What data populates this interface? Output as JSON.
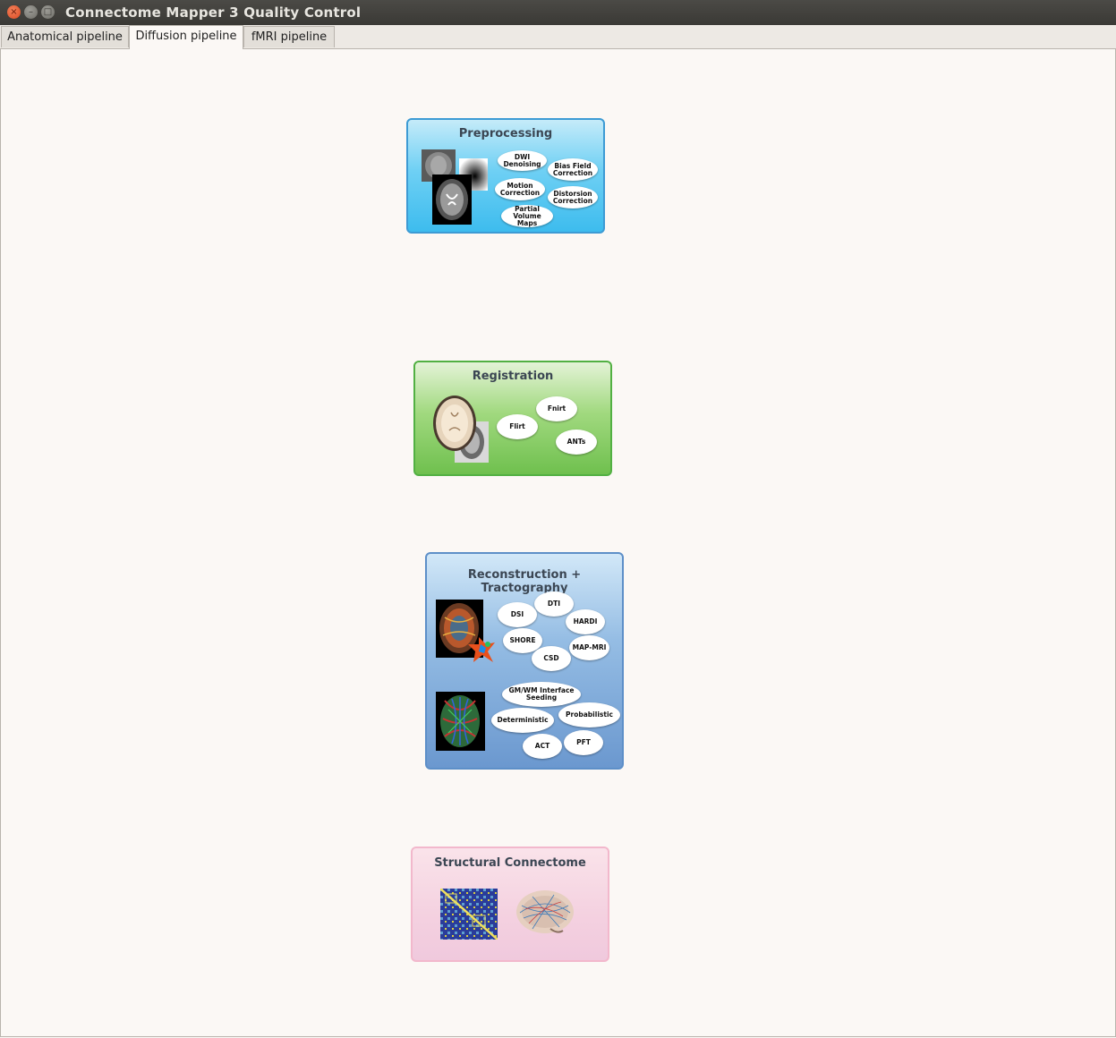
{
  "window": {
    "title": "Connectome Mapper 3 Quality Control",
    "close_symbol": "×",
    "min_symbol": "–",
    "max_symbol": "□"
  },
  "tabs": [
    "Anatomical pipeline",
    "Diffusion pipeline",
    "fMRI pipeline"
  ],
  "active_tab": "Diffusion pipeline",
  "stages": {
    "preprocessing": {
      "title": "Preprocessing",
      "color": "#50c0ee",
      "options": [
        "DWI Denoising",
        "Bias Field Correction",
        "Motion Correction",
        "Distorsion Correction",
        "Partial Volume Maps"
      ]
    },
    "registration": {
      "title": "Registration",
      "color": "#73c255",
      "options": [
        "Fnirt",
        "Flirt",
        "ANTs"
      ]
    },
    "reconstruction": {
      "title": "Reconstruction + Tractography",
      "color": "#6d99cf",
      "recon_options": [
        "DTI",
        "DSI",
        "HARDI",
        "SHORE",
        "MAP-MRI",
        "CSD"
      ],
      "tracto_options": [
        "GM/WM Interface Seeding",
        "Deterministic",
        "Probabilistic",
        "ACT",
        "PFT"
      ]
    },
    "connectome": {
      "title": "Structural Connectome",
      "color": "#f2cfe0"
    }
  }
}
